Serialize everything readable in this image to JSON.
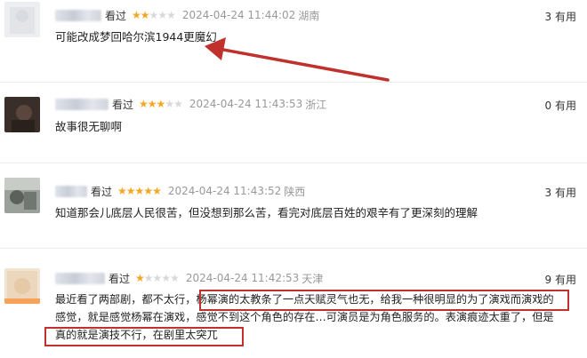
{
  "colors": {
    "star_on": "#f5a623",
    "star_off": "#d9d9d9",
    "annotation_red": "#c0302c",
    "meta_gray": "#999999"
  },
  "comments": [
    {
      "watched": "看过",
      "rating": 2,
      "time": "2024-04-24 11:44:02",
      "location": "湖南",
      "useful": "3 有用",
      "lines": [
        "可能改成梦回哈尔滨1944更魔幻"
      ]
    },
    {
      "watched": "看过",
      "rating": 3,
      "time": "2024-04-24 11:43:53",
      "location": "浙江",
      "useful": "0 有用",
      "lines": [
        "故事很无聊啊"
      ]
    },
    {
      "watched": "看过",
      "rating": 5,
      "time": "2024-04-24 11:43:52",
      "location": "陕西",
      "useful": "3 有用",
      "lines": [
        "知道那会儿底层人民很苦，但没想到那么苦，看完对底层百姓的艰辛有了更深刻的理解"
      ]
    },
    {
      "watched": "看过",
      "rating": 1,
      "time": "2024-04-24 11:42:53",
      "location": "天津",
      "useful": "9 有用",
      "lines": [
        "最近看了两部剧，都不太行，杨幂演的太教条了一点天赋灵气也无，给我一种很明显的为了演戏而演戏的",
        "感觉，就是感觉杨幂在演戏，感觉不到这个角色的存在…可演员是为角色服务的。表演痕迹太重了，但是",
        "真的就是演技不行，在剧里太突兀"
      ]
    }
  ]
}
